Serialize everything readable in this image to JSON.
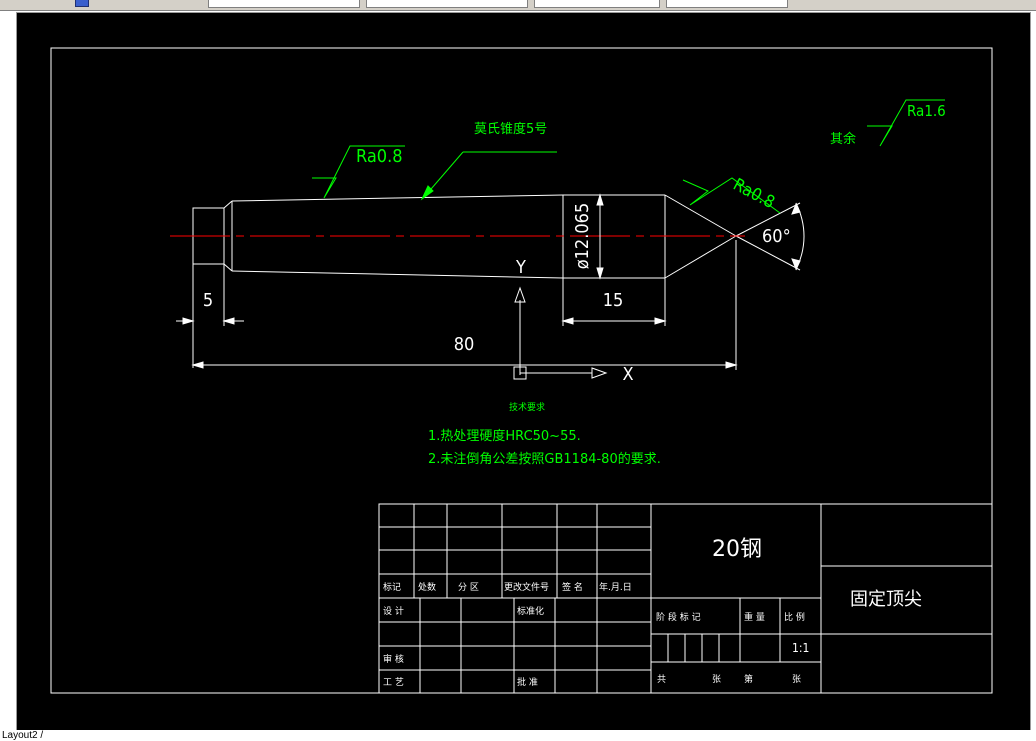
{
  "toolbar": {
    "icon": "layer-icon"
  },
  "drawing": {
    "surface_symbol_top": "Ra0.8",
    "heat_treat_note": "莫氏锥度5号",
    "surface_symbol_tip": "Ra0.8",
    "remaining_label": "其余",
    "remaining_symbol": "Ra1.6",
    "dim_diameter": "ø12.065",
    "dim_angle": "60°",
    "dim_5": "5",
    "dim_15": "15",
    "dim_80": "80",
    "ucs_y": "Y",
    "ucs_x": "X",
    "tech_title": "技术要求",
    "tech_req_1": "1.热处理硬度HRC50~55.",
    "tech_req_2": "2.未注倒角公差按照GB1184-80的要求."
  },
  "title_block": {
    "material": "20钢",
    "part_name": "固定顶尖",
    "hdr_mark": "标记",
    "hdr_count": "处数",
    "hdr_zone": "分 区",
    "hdr_doc": "更改文件号",
    "hdr_sign": "签 名",
    "hdr_date": "年.月.日",
    "design": "设 计",
    "standardize": "标准化",
    "review": "审 核",
    "process": "工 艺",
    "approve": "批 准",
    "stage_mark": "阶 段 标 记",
    "weight": "重 量",
    "scale_label": "比 例",
    "scale_value": "1:1",
    "total": "共",
    "sheets": "张",
    "page": "第",
    "sheet_word": "张"
  },
  "status": {
    "layout_tab": "Layout2 /"
  },
  "colors": {
    "background": "#000000",
    "lines": "#ffffff",
    "annotation": "#00ff00",
    "centerline": "#ff0000"
  }
}
